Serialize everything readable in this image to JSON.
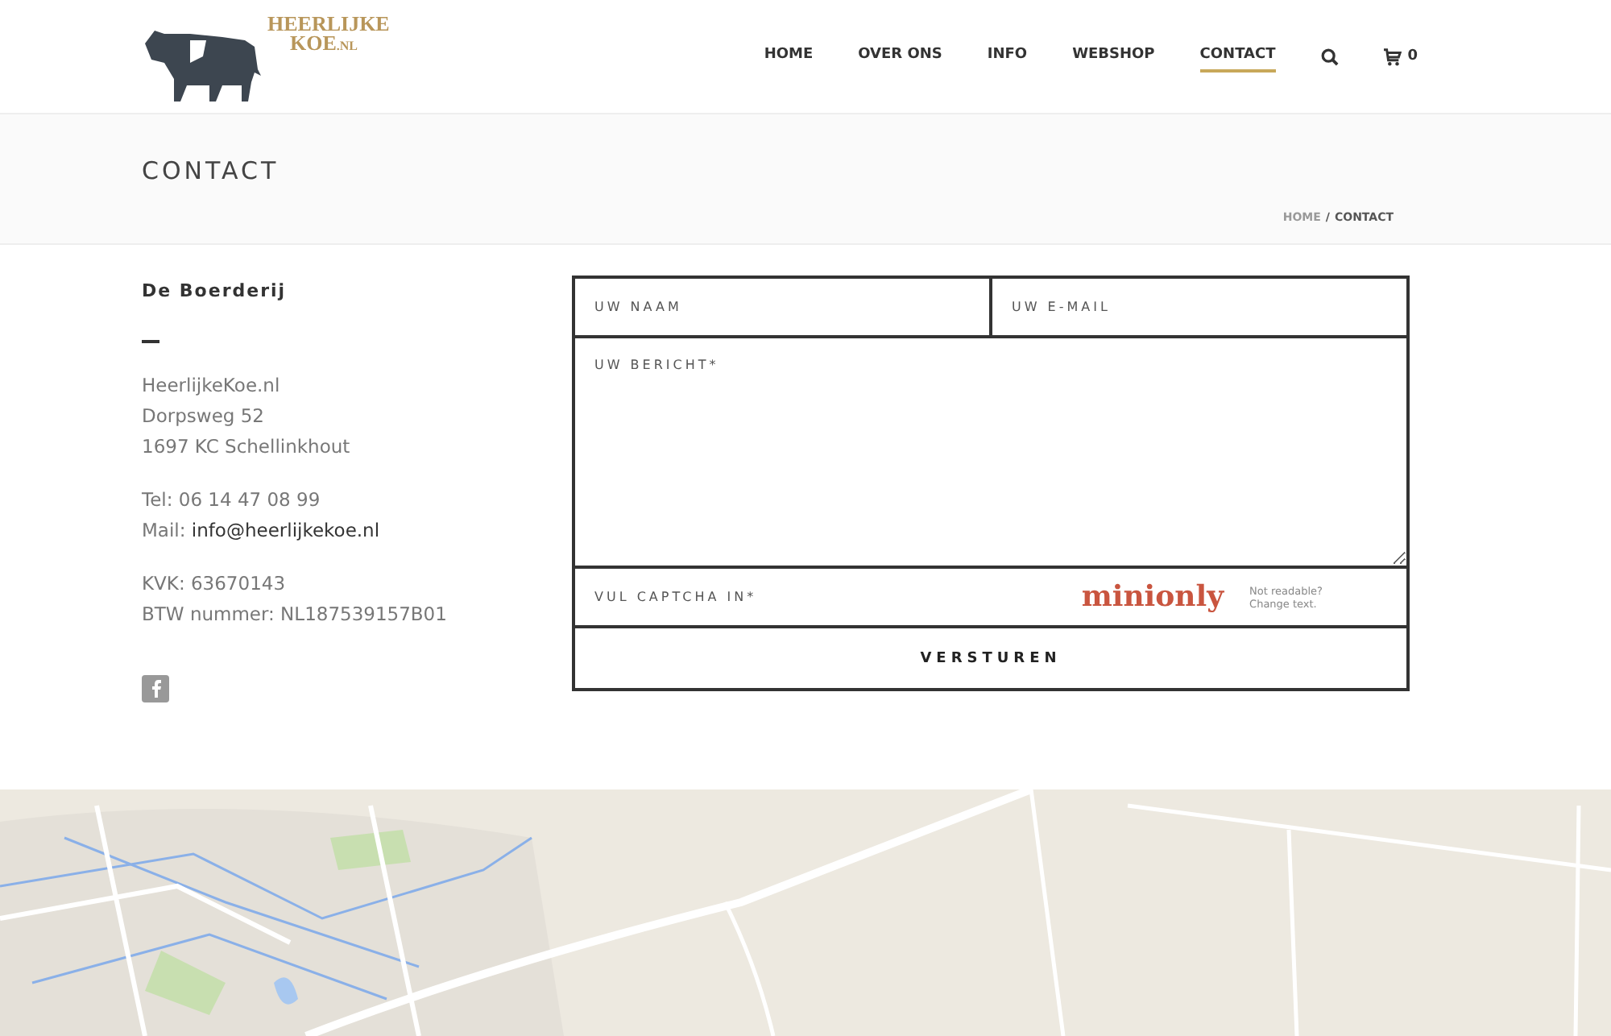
{
  "logo": {
    "line_1": "HEERLIJKE",
    "line_2": "KOE",
    "suffix": ".NL"
  },
  "nav": [
    {
      "label": "HOME",
      "selected": false
    },
    {
      "label": "OVER ONS",
      "selected": false
    },
    {
      "label": "INFO",
      "selected": false
    },
    {
      "label": "WEBSHOP",
      "selected": false
    },
    {
      "label": "CONTACT",
      "selected": true
    }
  ],
  "cart_count": "0",
  "page_title": "CONTACT",
  "breadcrumb": {
    "home": "HOME",
    "separator": "/",
    "current": "CONTACT"
  },
  "contact": {
    "heading": "De Boerderij",
    "address": [
      "HeerlijkeKoe.nl",
      "Dorpsweg 52",
      "1697 KC Schellinkhout"
    ],
    "phone": "Tel: 06 14 47 08 99",
    "mail_label": "Mail:",
    "mail": "info@heerlijkekoe.nl",
    "kvk": "KVK: 63670143",
    "btw": "BTW nummer: NL187539157B01"
  },
  "form": {
    "name_placeholder": "UW NAAM",
    "email_placeholder": "UW E-MAIL",
    "message_placeholder": "UW BERICHT*",
    "captcha_placeholder": "VUL CAPTCHA IN*",
    "captcha_text": "minionly",
    "captcha_refresh": [
      "Not readable?",
      "Change text."
    ],
    "submit": "VERSTUREN"
  }
}
